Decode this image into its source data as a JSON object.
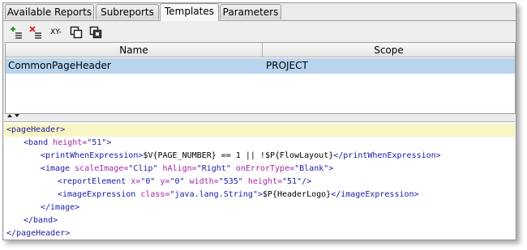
{
  "tabs": [
    {
      "label": "Available Reports"
    },
    {
      "label": "Subreports"
    },
    {
      "label": "Templates"
    },
    {
      "label": "Parameters"
    }
  ],
  "active_tab": "Templates",
  "toolbar": [
    {
      "icon": "add-list-icon"
    },
    {
      "icon": "remove-list-icon"
    },
    {
      "icon": "xy-icon",
      "label": "XY-"
    },
    {
      "icon": "copy-icon"
    },
    {
      "icon": "copy-all-icon"
    }
  ],
  "table": {
    "columns": [
      "Name",
      "Scope"
    ],
    "rows": [
      {
        "name": "CommonPageHeader",
        "scope": "PROJECT"
      }
    ]
  },
  "editor": {
    "lines": [
      {
        "indent": 0,
        "parts": [
          [
            "tag",
            "<pageHeader>"
          ]
        ]
      },
      {
        "indent": 1,
        "parts": [
          [
            "tag",
            "<band "
          ],
          [
            "attr",
            "height="
          ],
          [
            "val",
            "\"51\""
          ],
          [
            "tag",
            ">"
          ]
        ]
      },
      {
        "indent": 2,
        "parts": [
          [
            "tag",
            "<printWhenExpression>"
          ],
          [
            "txt",
            "$V{PAGE_NUMBER} == 1 || !$P{FlowLayout}"
          ],
          [
            "tag",
            "</printWhenExpression>"
          ]
        ]
      },
      {
        "indent": 2,
        "parts": [
          [
            "tag",
            "<image "
          ],
          [
            "attr",
            "scaleImage="
          ],
          [
            "val",
            "\"Clip\" "
          ],
          [
            "attr",
            "hAlign="
          ],
          [
            "val",
            "\"Right\" "
          ],
          [
            "attr",
            "onErrorType="
          ],
          [
            "val",
            "\"Blank\""
          ],
          [
            "tag",
            ">"
          ]
        ]
      },
      {
        "indent": 3,
        "parts": [
          [
            "tag",
            "<reportElement "
          ],
          [
            "attr",
            "x="
          ],
          [
            "val",
            "\"0\" "
          ],
          [
            "attr",
            "y="
          ],
          [
            "val",
            "\"0\" "
          ],
          [
            "attr",
            "width="
          ],
          [
            "val",
            "\"535\" "
          ],
          [
            "attr",
            "height="
          ],
          [
            "val",
            "\"51\""
          ],
          [
            "tag",
            "/>"
          ]
        ]
      },
      {
        "indent": 3,
        "parts": [
          [
            "tag",
            "<imageExpression "
          ],
          [
            "attr",
            "class="
          ],
          [
            "val",
            "\"java.lang.String\""
          ],
          [
            "tag",
            ">"
          ],
          [
            "txt",
            "$P{HeaderLogo}"
          ],
          [
            "tag",
            "</imageExpression>"
          ]
        ]
      },
      {
        "indent": 2,
        "parts": [
          [
            "tag",
            "</image>"
          ]
        ]
      },
      {
        "indent": 1,
        "parts": [
          [
            "tag",
            "</band>"
          ]
        ]
      },
      {
        "indent": 0,
        "parts": [
          [
            "tag",
            "</pageHeader>"
          ]
        ]
      }
    ]
  },
  "colors": {
    "selected_row": "#b8d4ef",
    "highlight_line": "#f8f5c4",
    "tag": "#1a1aa6",
    "attr": "#a626a4"
  }
}
